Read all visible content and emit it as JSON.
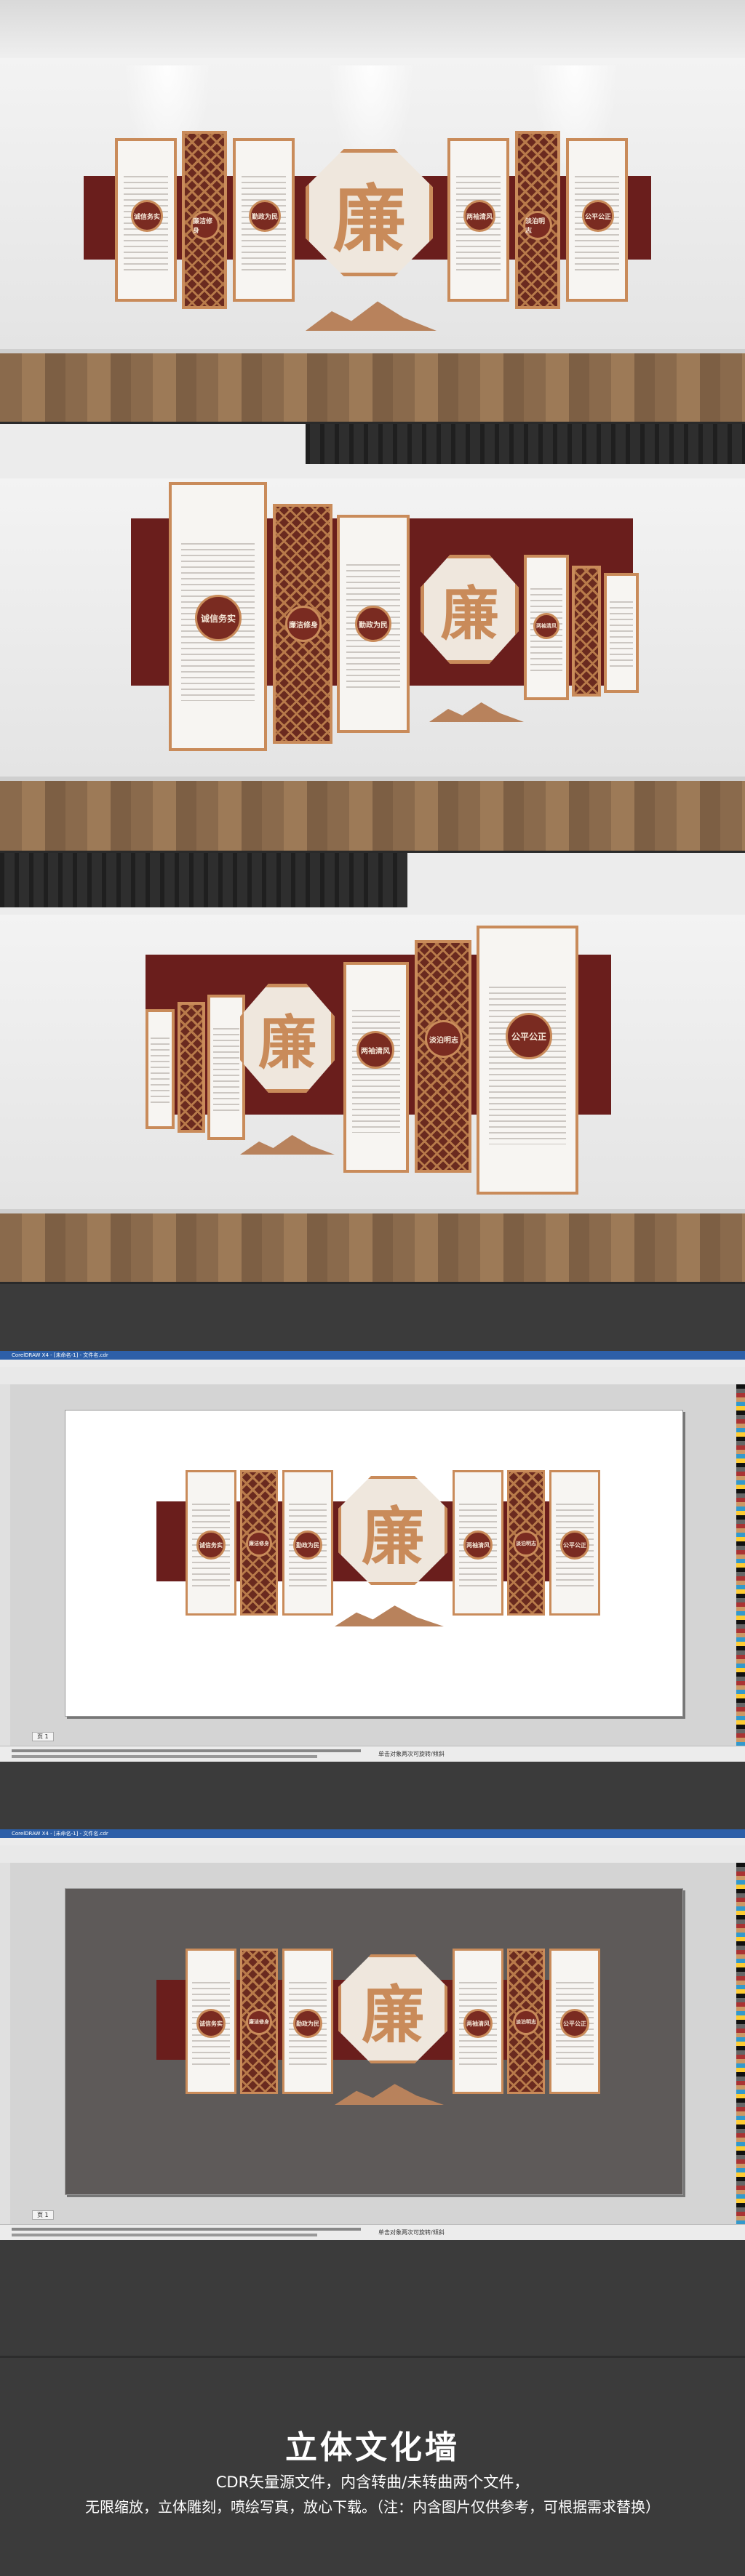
{
  "wall_words": {
    "lian": "廉",
    "slogan_1": "诚信务实",
    "slogan_2": "廉洁修身",
    "slogan_3": "勤政为民",
    "slogan_4": "两袖清风",
    "slogan_5": "淡泊明志",
    "slogan_6": "公平公正"
  },
  "software": {
    "window_title": "CorelDRAW X4 - [未命名-1] - 文件名.cdr",
    "tab_label": "页 1",
    "status_text": "单击对象两次可旋转/倾斜"
  },
  "footer": {
    "title": "立体文化墙",
    "line1": "CDR矢量源文件，内含转曲/未转曲两个文件，",
    "line2": "无限缩放，立体雕刻，喷绘写真，放心下载。（注：内含图片仅供参考，可根据需求替换）"
  },
  "colors": {
    "maroon": "#6a1e1c",
    "copper": "#c98b5a",
    "background": "#3b3b3b"
  }
}
